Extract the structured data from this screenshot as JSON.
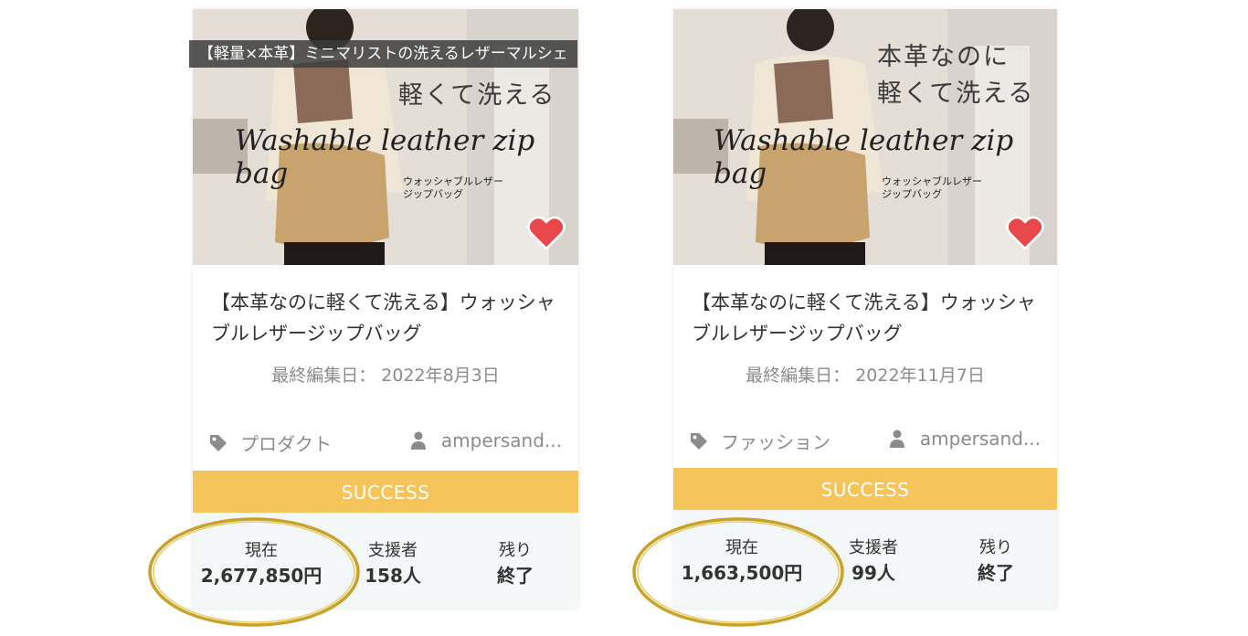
{
  "colors": {
    "status_bar": "#f5c45a",
    "heart": "#e8474c",
    "stats_bg": "#f3f7f8",
    "gold_ring": "#c9a227"
  },
  "cards": [
    {
      "overlay_title": "【軽量×本革】ミニマリストの洗えるレザーマルシェ",
      "image_text": {
        "jp_heading": "軽くて洗える",
        "script_heading": "Washable leather zip bag",
        "sub_line_1": "ウォッシャブルレザー",
        "sub_line_2": "ジップバッグ"
      },
      "favorite_icon": "heart-icon",
      "title": "【本革なのに軽くて洗える】ウォッシャブルレザージップバッグ",
      "last_edited": "最終編集日： 2022年8月3日",
      "category": "プロダクト",
      "author": "ampersand...",
      "status": "SUCCESS",
      "stats": {
        "current_label": "現在",
        "current_value": "2,677,850円",
        "backers_label": "支援者",
        "backers_value": "158人",
        "remaining_label": "残り",
        "remaining_value": "終了"
      }
    },
    {
      "image_text": {
        "jp_heading_1": "本革なのに",
        "jp_heading_2": "軽くて洗える",
        "script_heading": "Washable leather zip bag",
        "sub_line_1": "ウォッシャブルレザー",
        "sub_line_2": "ジップバッグ"
      },
      "favorite_icon": "heart-icon",
      "title": "【本革なのに軽くて洗える】ウォッシャブルレザージップバッグ",
      "last_edited": "最終編集日： 2022年11月7日",
      "category": "ファッション",
      "author": "ampersand...",
      "status": "SUCCESS",
      "stats": {
        "current_label": "現在",
        "current_value": "1,663,500円",
        "backers_label": "支援者",
        "backers_value": "99人",
        "remaining_label": "残り",
        "remaining_value": "終了"
      }
    }
  ]
}
